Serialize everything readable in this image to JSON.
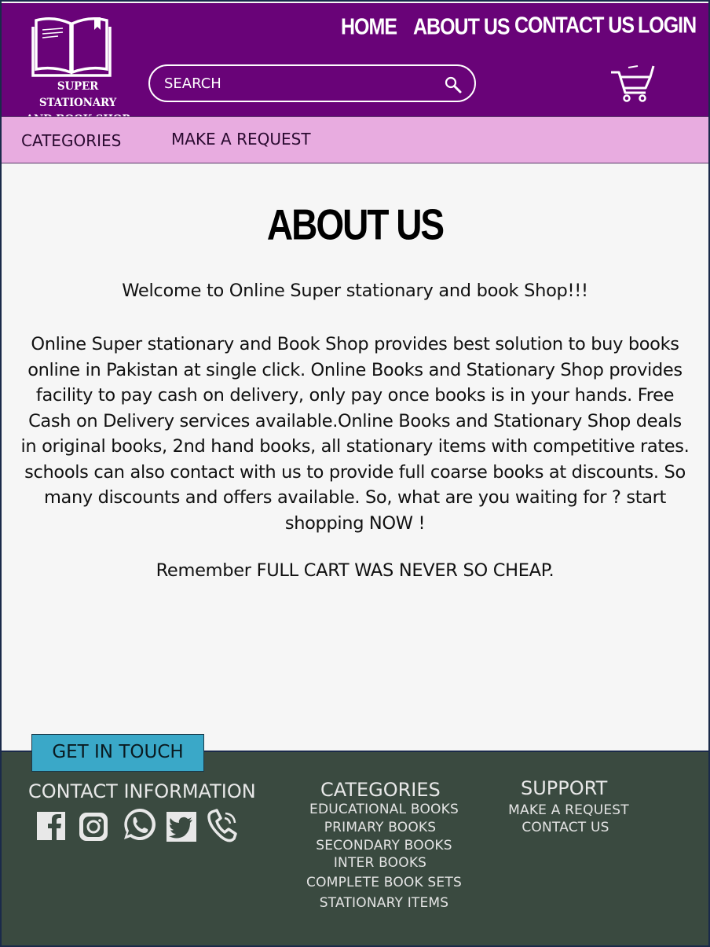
{
  "brand": {
    "line1": "SUPER STATIONARY",
    "line2": "AND BOOK SHOP"
  },
  "nav": {
    "home": "HOME",
    "about": "ABOUT US",
    "contact": "CONTACT US",
    "login": "LOGIN"
  },
  "search": {
    "placeholder": "SEARCH"
  },
  "subnav": {
    "categories": "CATEGORIES",
    "request": "MAKE A REQUEST"
  },
  "main": {
    "title": "ABOUT US",
    "welcome": "Welcome to Online Super stationary and book Shop!!!",
    "body": "Online Super stationary and Book Shop provides best solution to buy books online in Pakistan at single click. Online Books and Stationary Shop provides facility to pay cash on delivery, only pay once books is in your hands. Free Cash on Delivery services available.Online Books and Stationary Shop deals in original books, 2nd hand books, all stationary items with competitive rates. schools can also contact with us to provide full coarse books at discounts. So many discounts and offers available. So, what are you waiting for ? start shopping NOW !",
    "remember": "Remember FULL CART WAS NEVER SO CHEAP."
  },
  "footer": {
    "button": "GET IN TOUCH",
    "contact_heading": "CONTACT INFORMATION",
    "categories_heading": "CATEGORIES",
    "categories": [
      "EDUCATIONAL BOOKS",
      "PRIMARY BOOKS",
      "SECONDARY BOOKS",
      "INTER BOOKS",
      "COMPLETE BOOK SETS",
      "STATIONARY ITEMS"
    ],
    "support_heading": "SUPPORT",
    "support": [
      "MAKE A REQUEST",
      "CONTACT US"
    ],
    "social_icons": [
      "facebook-icon",
      "instagram-icon",
      "whatsapp-icon",
      "twitter-icon",
      "phone-icon"
    ]
  },
  "colors": {
    "header": "#690378",
    "subnav": "#e8ace0",
    "footer": "#3a4a40",
    "button": "#3aa8c8"
  }
}
